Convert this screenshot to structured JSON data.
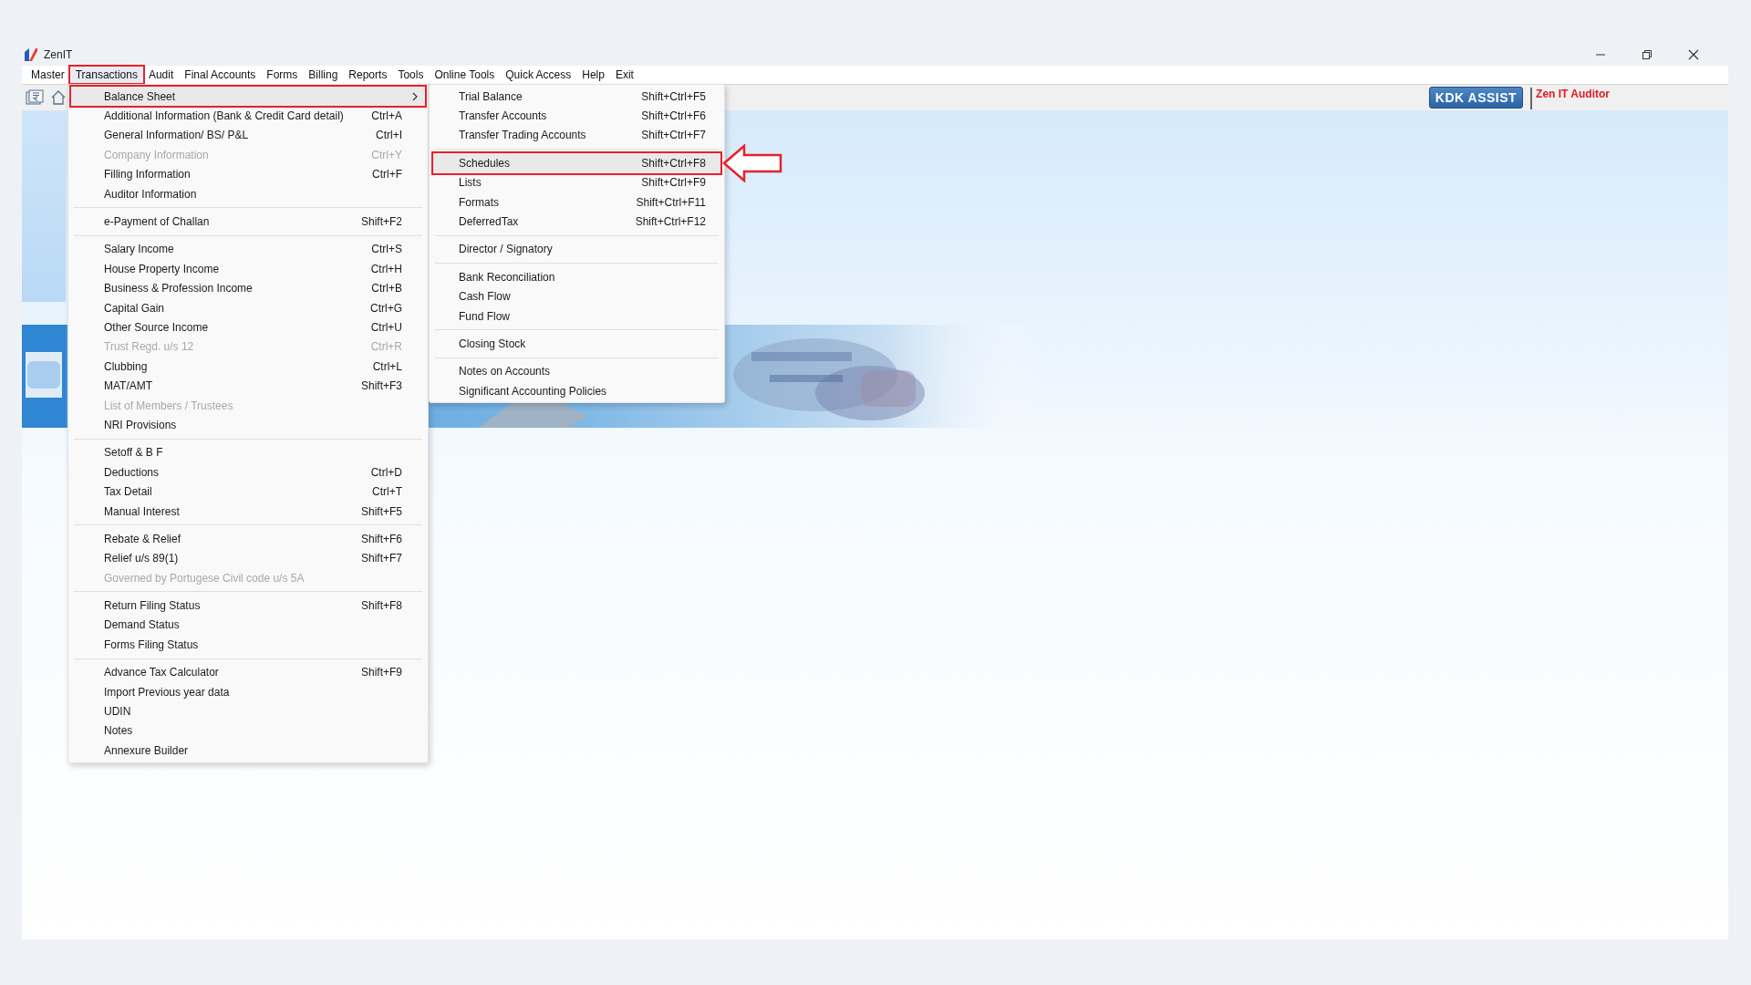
{
  "window": {
    "title": "ZenIT"
  },
  "menubar": [
    {
      "label": "Master",
      "selected": false,
      "marked": false
    },
    {
      "label": "Transactions",
      "selected": true,
      "marked": true
    },
    {
      "label": "Audit",
      "selected": false,
      "marked": false
    },
    {
      "label": "Final Accounts",
      "selected": false,
      "marked": false
    },
    {
      "label": "Forms",
      "selected": false,
      "marked": false
    },
    {
      "label": "Billing",
      "selected": false,
      "marked": false
    },
    {
      "label": "Reports",
      "selected": false,
      "marked": false
    },
    {
      "label": "Tools",
      "selected": false,
      "marked": false
    },
    {
      "label": "Online Tools",
      "selected": false,
      "marked": false
    },
    {
      "label": "Quick Access",
      "selected": false,
      "marked": false
    },
    {
      "label": "Help",
      "selected": false,
      "marked": false
    },
    {
      "label": "Exit",
      "selected": false,
      "marked": false
    }
  ],
  "toolbar": {
    "assist_button": "KDK ASSIST",
    "product_label": "Zen IT Auditor"
  },
  "transactions_menu": {
    "groups": [
      [
        {
          "label": "Balance Sheet",
          "disabled": false,
          "selected": true,
          "marked": true,
          "has_submenu": true
        },
        {
          "label": "Additional Information (Bank & Credit Card detail)",
          "shortcut": "Ctrl+A",
          "disabled": false,
          "selected": false,
          "marked": false,
          "has_submenu": false
        },
        {
          "label": "General Information/ BS/ P&L",
          "shortcut": "Ctrl+I",
          "disabled": false,
          "selected": false,
          "marked": false,
          "has_submenu": false
        },
        {
          "label": "Company Information",
          "shortcut": "Ctrl+Y",
          "disabled": true,
          "selected": false,
          "marked": false,
          "has_submenu": false
        },
        {
          "label": "Filling Information",
          "shortcut": "Ctrl+F",
          "disabled": false,
          "selected": false,
          "marked": false,
          "has_submenu": false
        },
        {
          "label": "Auditor Information",
          "disabled": false,
          "selected": false,
          "marked": false,
          "has_submenu": false
        }
      ],
      [
        {
          "label": "e-Payment of Challan",
          "shortcut": "Shift+F2",
          "disabled": false,
          "selected": false,
          "marked": false,
          "has_submenu": false
        }
      ],
      [
        {
          "label": "Salary Income",
          "shortcut": "Ctrl+S",
          "disabled": false,
          "selected": false,
          "marked": false,
          "has_submenu": false
        },
        {
          "label": "House Property Income",
          "shortcut": "Ctrl+H",
          "disabled": false,
          "selected": false,
          "marked": false,
          "has_submenu": false
        },
        {
          "label": "Business & Profession Income",
          "shortcut": "Ctrl+B",
          "disabled": false,
          "selected": false,
          "marked": false,
          "has_submenu": false
        },
        {
          "label": "Capital Gain",
          "shortcut": "Ctrl+G",
          "disabled": false,
          "selected": false,
          "marked": false,
          "has_submenu": false
        },
        {
          "label": "Other Source Income",
          "shortcut": "Ctrl+U",
          "disabled": false,
          "selected": false,
          "marked": false,
          "has_submenu": false
        },
        {
          "label": "Trust Regd. u/s 12",
          "shortcut": "Ctrl+R",
          "disabled": true,
          "selected": false,
          "marked": false,
          "has_submenu": false
        },
        {
          "label": "Clubbing",
          "shortcut": "Ctrl+L",
          "disabled": false,
          "selected": false,
          "marked": false,
          "has_submenu": false
        },
        {
          "label": "MAT/AMT",
          "shortcut": "Shift+F3",
          "disabled": false,
          "selected": false,
          "marked": false,
          "has_submenu": false
        },
        {
          "label": "List of Members / Trustees",
          "disabled": true,
          "selected": false,
          "marked": false,
          "has_submenu": false
        },
        {
          "label": "NRI Provisions",
          "disabled": false,
          "selected": false,
          "marked": false,
          "has_submenu": false
        }
      ],
      [
        {
          "label": "Setoff & B F",
          "disabled": false,
          "selected": false,
          "marked": false,
          "has_submenu": false
        },
        {
          "label": "Deductions",
          "shortcut": "Ctrl+D",
          "disabled": false,
          "selected": false,
          "marked": false,
          "has_submenu": false
        },
        {
          "label": "Tax Detail",
          "shortcut": "Ctrl+T",
          "disabled": false,
          "selected": false,
          "marked": false,
          "has_submenu": false
        },
        {
          "label": "Manual Interest",
          "shortcut": "Shift+F5",
          "disabled": false,
          "selected": false,
          "marked": false,
          "has_submenu": false
        }
      ],
      [
        {
          "label": "Rebate & Relief",
          "shortcut": "Shift+F6",
          "disabled": false,
          "selected": false,
          "marked": false,
          "has_submenu": false
        },
        {
          "label": "Relief u/s 89(1)",
          "shortcut": "Shift+F7",
          "disabled": false,
          "selected": false,
          "marked": false,
          "has_submenu": false
        },
        {
          "label": "Governed by Portugese Civil code u/s 5A",
          "disabled": true,
          "selected": false,
          "marked": false,
          "has_submenu": false
        }
      ],
      [
        {
          "label": "Return Filing Status",
          "shortcut": "Shift+F8",
          "disabled": false,
          "selected": false,
          "marked": false,
          "has_submenu": false
        },
        {
          "label": "Demand Status",
          "disabled": false,
          "selected": false,
          "marked": false,
          "has_submenu": false
        },
        {
          "label": "Forms Filing Status",
          "disabled": false,
          "selected": false,
          "marked": false,
          "has_submenu": false
        }
      ],
      [
        {
          "label": "Advance Tax Calculator",
          "shortcut": "Shift+F9",
          "disabled": false,
          "selected": false,
          "marked": false,
          "has_submenu": false
        },
        {
          "label": "Import Previous year data",
          "disabled": false,
          "selected": false,
          "marked": false,
          "has_submenu": false
        },
        {
          "label": "UDIN",
          "disabled": false,
          "selected": false,
          "marked": false,
          "has_submenu": false
        },
        {
          "label": "Notes",
          "disabled": false,
          "selected": false,
          "marked": false,
          "has_submenu": false
        },
        {
          "label": "Annexure Builder",
          "disabled": false,
          "selected": false,
          "marked": false,
          "has_submenu": false
        }
      ]
    ]
  },
  "balance_sheet_submenu": {
    "groups": [
      [
        {
          "label": "Trial Balance",
          "shortcut": "Shift+Ctrl+F5",
          "selected": false,
          "marked": false,
          "pointed": false
        },
        {
          "label": "Transfer Accounts",
          "shortcut": "Shift+Ctrl+F6",
          "selected": false,
          "marked": false,
          "pointed": false
        },
        {
          "label": "Transfer Trading Accounts",
          "shortcut": "Shift+Ctrl+F7",
          "selected": false,
          "marked": false,
          "pointed": false
        }
      ],
      [
        {
          "label": "Schedules",
          "shortcut": "Shift+Ctrl+F8",
          "selected": true,
          "marked": true,
          "pointed": true
        },
        {
          "label": "Lists",
          "shortcut": "Shift+Ctrl+F9",
          "selected": false,
          "marked": false,
          "pointed": false
        },
        {
          "label": "Formats",
          "shortcut": "Shift+Ctrl+F11",
          "selected": false,
          "marked": false,
          "pointed": false
        },
        {
          "label": "DeferredTax",
          "shortcut": "Shift+Ctrl+F12",
          "selected": false,
          "marked": false,
          "pointed": false
        }
      ],
      [
        {
          "label": "Director / Signatory",
          "selected": false,
          "marked": false,
          "pointed": false
        }
      ],
      [
        {
          "label": "Bank Reconciliation",
          "selected": false,
          "marked": false,
          "pointed": false
        },
        {
          "label": "Cash Flow",
          "selected": false,
          "marked": false,
          "pointed": false
        },
        {
          "label": "Fund Flow",
          "selected": false,
          "marked": false,
          "pointed": false
        }
      ],
      [
        {
          "label": "Closing Stock",
          "selected": false,
          "marked": false,
          "pointed": false
        }
      ],
      [
        {
          "label": "Notes on Accounts",
          "selected": false,
          "marked": false,
          "pointed": false
        },
        {
          "label": "Significant Accounting Policies",
          "selected": false,
          "marked": false,
          "pointed": false
        }
      ]
    ]
  }
}
